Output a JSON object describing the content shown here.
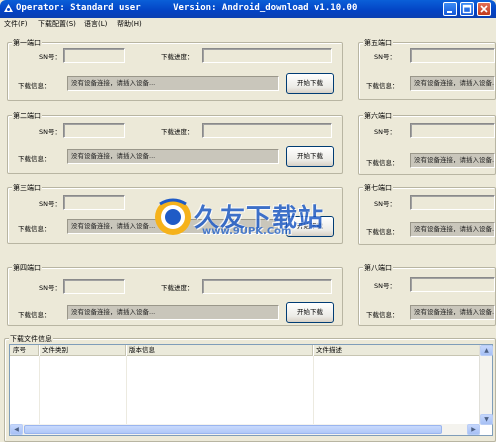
{
  "window": {
    "title": "Operator: Standard user      Version: Android_download v1.10.00"
  },
  "menu": [
    {
      "label": "文件(F)"
    },
    {
      "label": "下载配置(S)"
    },
    {
      "label": "语言(L)"
    },
    {
      "label": "帮助(H)"
    }
  ],
  "ports": [
    {
      "title": "第一端口",
      "sn_label": "SN号：",
      "progress_label": "下载进度：",
      "info_label": "下载信息：",
      "status": "没有设备连接，请插入设备...",
      "button": "开始下载"
    },
    {
      "title": "第二端口",
      "sn_label": "SN号：",
      "progress_label": "下载进度：",
      "info_label": "下载信息：",
      "status": "没有设备连接，请插入设备...",
      "button": "开始下载"
    },
    {
      "title": "第三端口",
      "sn_label": "SN号：",
      "progress_label": "下载进度：",
      "info_label": "下载信息：",
      "status": "没有设备连接，请插入设备...",
      "button": "开始下载"
    },
    {
      "title": "第四端口",
      "sn_label": "SN号：",
      "progress_label": "下载进度：",
      "info_label": "下载信息：",
      "status": "没有设备连接，请插入设备...",
      "button": "开始下载"
    },
    {
      "title": "第五端口",
      "sn_label": "SN号：",
      "info_label": "下载信息：",
      "status": "没有设备连接，请插入设备..."
    },
    {
      "title": "第六端口",
      "sn_label": "SN号：",
      "info_label": "下载信息：",
      "status": "没有设备连接，请插入设备..."
    },
    {
      "title": "第七端口",
      "sn_label": "SN号：",
      "info_label": "下载信息：",
      "status": "没有设备连接，请插入设备..."
    },
    {
      "title": "第八端口",
      "sn_label": "SN号：",
      "info_label": "下载信息：",
      "status": "没有设备连接，请插入设备..."
    }
  ],
  "files": {
    "title": "下载文件信息",
    "columns": [
      "序号",
      "文件类别",
      "版本信息",
      "文件描述"
    ]
  },
  "watermark": {
    "text": "久友下载站",
    "url": "www.9UPK.Com"
  }
}
